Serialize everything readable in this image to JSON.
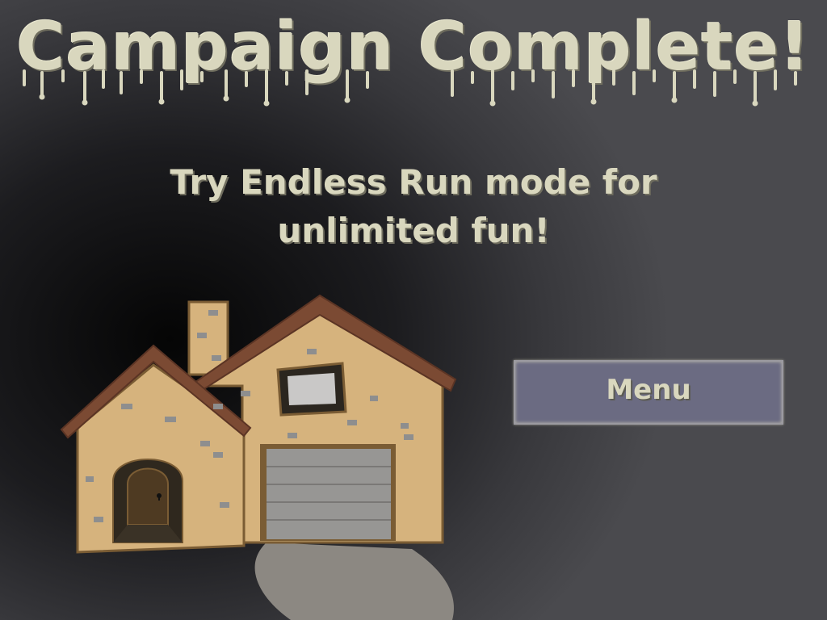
{
  "screen": {
    "title": "Campaign Complete!",
    "subtitle": "Try Endless Run mode for unlimited fun!",
    "menu_button_label": "Menu"
  },
  "illustration": {
    "house_icon": "house-icon",
    "path_icon": "garden-path-icon"
  },
  "colors": {
    "text": "#d9d7be",
    "button_fill": "#6b6b82",
    "wall": "#d6b37d",
    "roof": "#7b4a33",
    "garage_door": "#979694",
    "path": "#8c8882"
  }
}
